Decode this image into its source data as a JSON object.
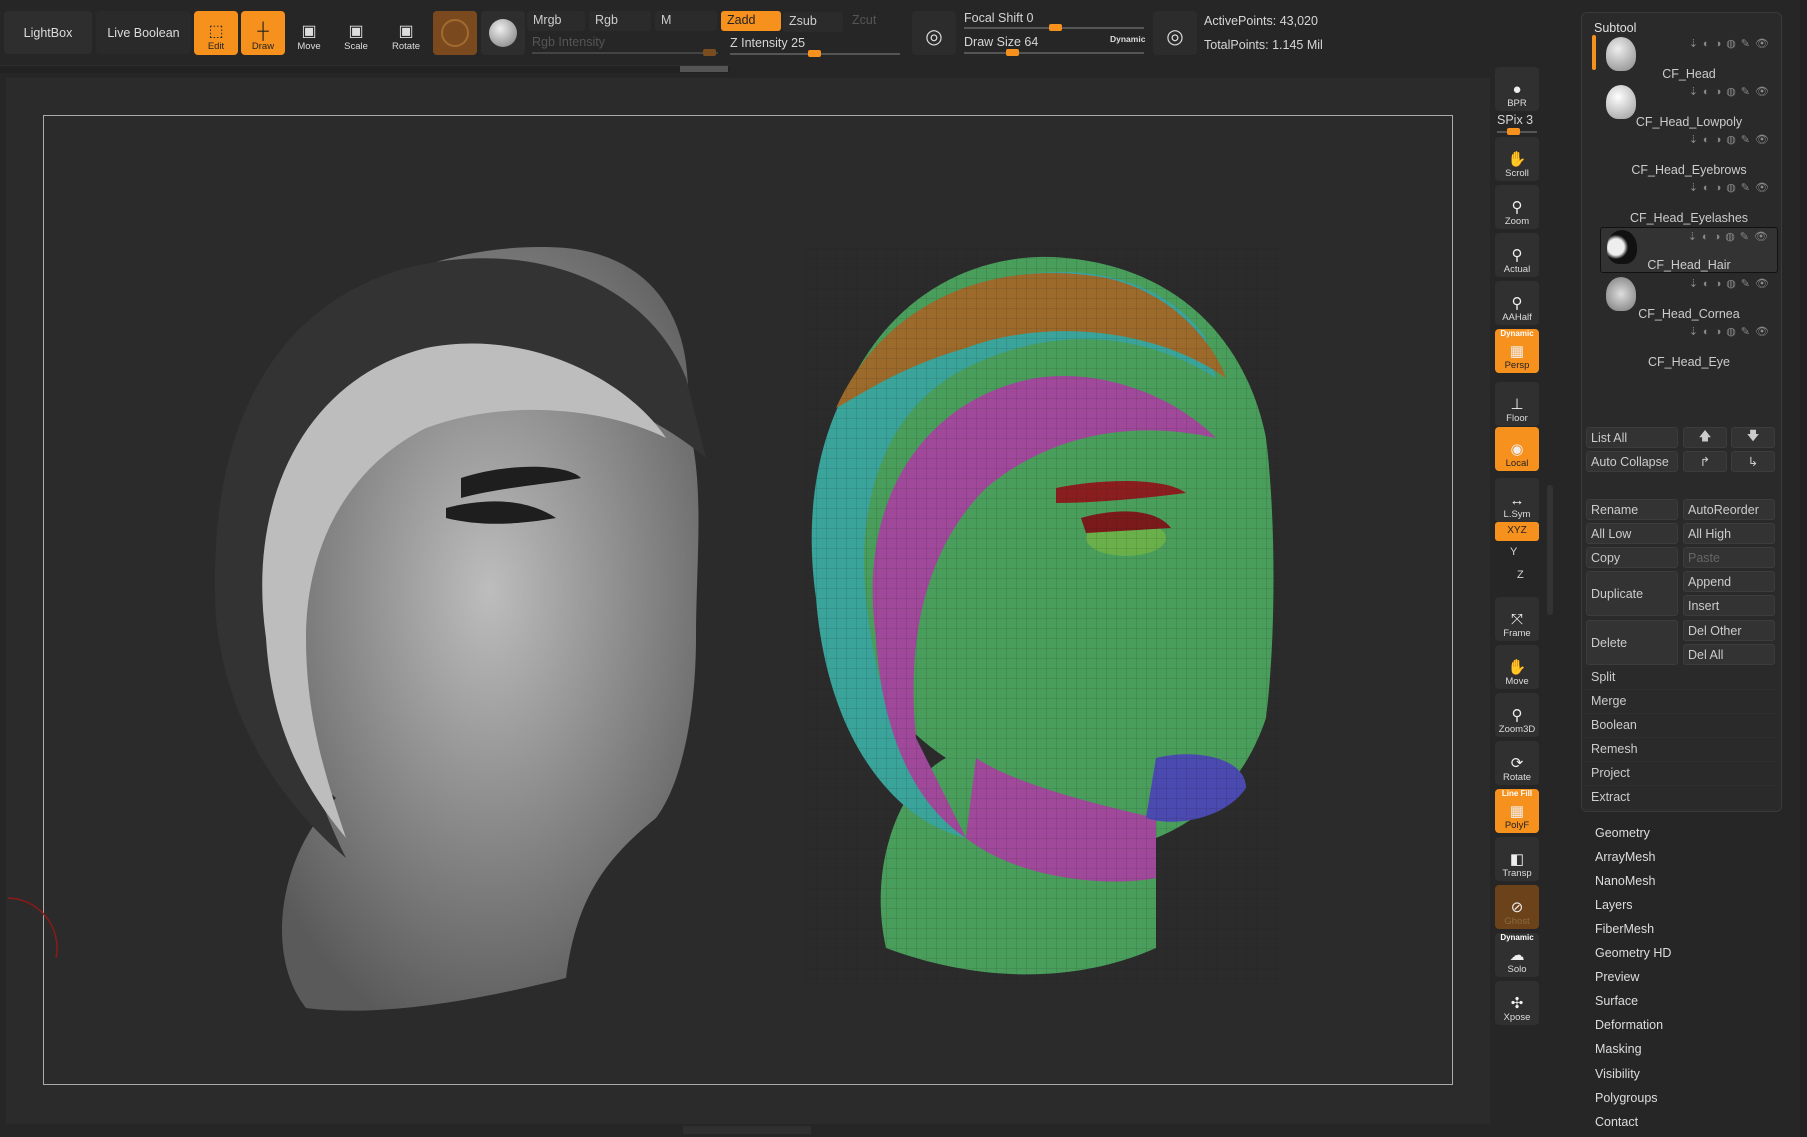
{
  "topbar": {
    "lightbox": "LightBox",
    "live_boolean": "Live Boolean",
    "edit": "Edit",
    "draw": "Draw",
    "move": "Move",
    "scale": "Scale",
    "rotate": "Rotate",
    "modes": {
      "mrgb": "Mrgb",
      "rgb": "Rgb",
      "m": "M",
      "zadd": "Zadd",
      "zsub": "Zsub",
      "zcut": "Zcut"
    },
    "rgb_intensity": "Rgb Intensity",
    "z_intensity": "Z Intensity 25",
    "focal_shift": "Focal Shift 0",
    "draw_size": "Draw Size 64",
    "dynamic": "Dynamic",
    "active_points": "ActivePoints: 43,020",
    "total_points": "TotalPoints: 1.145 Mil",
    "z_intensity_value": 25,
    "focal_shift_value": 0,
    "draw_size_value": 64
  },
  "shelf": {
    "spix": "SPix 3",
    "buttons": [
      {
        "label": "BPR",
        "icon": "sphere-icon",
        "glyph": "●",
        "active": false,
        "top": ""
      },
      {
        "label": "Scroll",
        "icon": "hand-icon",
        "glyph": "✋",
        "active": false,
        "top": ""
      },
      {
        "label": "Zoom",
        "icon": "magnifier-icon",
        "glyph": "⚲",
        "active": false,
        "top": ""
      },
      {
        "label": "Actual",
        "icon": "magnifier-x1-icon",
        "glyph": "⚲",
        "active": false,
        "top": ""
      },
      {
        "label": "AAHalf",
        "icon": "magnifier-half-icon",
        "glyph": "⚲",
        "active": false,
        "top": ""
      },
      {
        "label": "Persp",
        "icon": "perspective-grid-icon",
        "glyph": "▦",
        "active": true,
        "top": "Dynamic"
      },
      {
        "label": "Floor",
        "icon": "floor-icon",
        "glyph": "⊥",
        "active": false,
        "top": ""
      },
      {
        "label": "Local",
        "icon": "local-icon",
        "glyph": "◉",
        "active": true,
        "top": ""
      },
      {
        "label": "L.Sym",
        "icon": "symmetry-icon",
        "glyph": "↔",
        "active": false,
        "top": ""
      },
      {
        "label": "Frame",
        "icon": "frame-icon",
        "glyph": "⤧",
        "active": false,
        "top": ""
      },
      {
        "label": "Move",
        "icon": "hand-move-icon",
        "glyph": "✋",
        "active": false,
        "top": ""
      },
      {
        "label": "Zoom3D",
        "icon": "zoom3d-icon",
        "glyph": "⚲",
        "active": false,
        "top": ""
      },
      {
        "label": "Rotate",
        "icon": "rotate-icon",
        "glyph": "⟳",
        "active": false,
        "top": ""
      },
      {
        "label": "PolyF",
        "icon": "polyframe-icon",
        "glyph": "▦",
        "active": true,
        "top": "Line Fill"
      },
      {
        "label": "Transp",
        "icon": "transparency-icon",
        "glyph": "◧",
        "active": false,
        "top": ""
      },
      {
        "label": "Ghost",
        "icon": "ghost-icon",
        "glyph": "⊘",
        "active": "dim",
        "top": ""
      },
      {
        "label": "Solo",
        "icon": "solo-icon",
        "glyph": "☁",
        "active": false,
        "top": "Dynamic"
      },
      {
        "label": "Xpose",
        "icon": "xpose-icon",
        "glyph": "✣",
        "active": false,
        "top": ""
      }
    ],
    "xyz": "XYZ",
    "rot_y": "Y",
    "rot_z": "Z"
  },
  "subtool": {
    "title": "Subtool",
    "items": [
      {
        "name": "CF_Head",
        "selected": false,
        "active": true
      },
      {
        "name": "CF_Head_Lowpoly",
        "selected": false,
        "active": false
      },
      {
        "name": "CF_Head_Eyebrows",
        "selected": false,
        "active": false
      },
      {
        "name": "CF_Head_Eyelashes",
        "selected": false,
        "active": false
      },
      {
        "name": "CF_Head_Hair",
        "selected": true,
        "active": false
      },
      {
        "name": "CF_Head_Cornea",
        "selected": false,
        "active": false
      },
      {
        "name": "CF_Head_Eye",
        "selected": false,
        "active": false
      }
    ],
    "list_all": "List All",
    "auto_collapse": "Auto Collapse",
    "rename": "Rename",
    "auto_reorder": "AutoReorder",
    "all_low": "All Low",
    "all_high": "All High",
    "copy": "Copy",
    "paste": "Paste",
    "duplicate": "Duplicate",
    "append": "Append",
    "insert": "Insert",
    "delete": "Delete",
    "del_other": "Del Other",
    "del_all": "Del All",
    "sections": [
      "Split",
      "Merge",
      "Boolean",
      "Remesh",
      "Project",
      "Extract"
    ]
  },
  "menus": [
    "Geometry",
    "ArrayMesh",
    "NanoMesh",
    "Layers",
    "FiberMesh",
    "Geometry HD",
    "Preview",
    "Surface",
    "Deformation",
    "Masking",
    "Visibility",
    "Polygroups",
    "Contact"
  ],
  "colors": {
    "accent": "#f7911e",
    "bg": "#262626"
  }
}
